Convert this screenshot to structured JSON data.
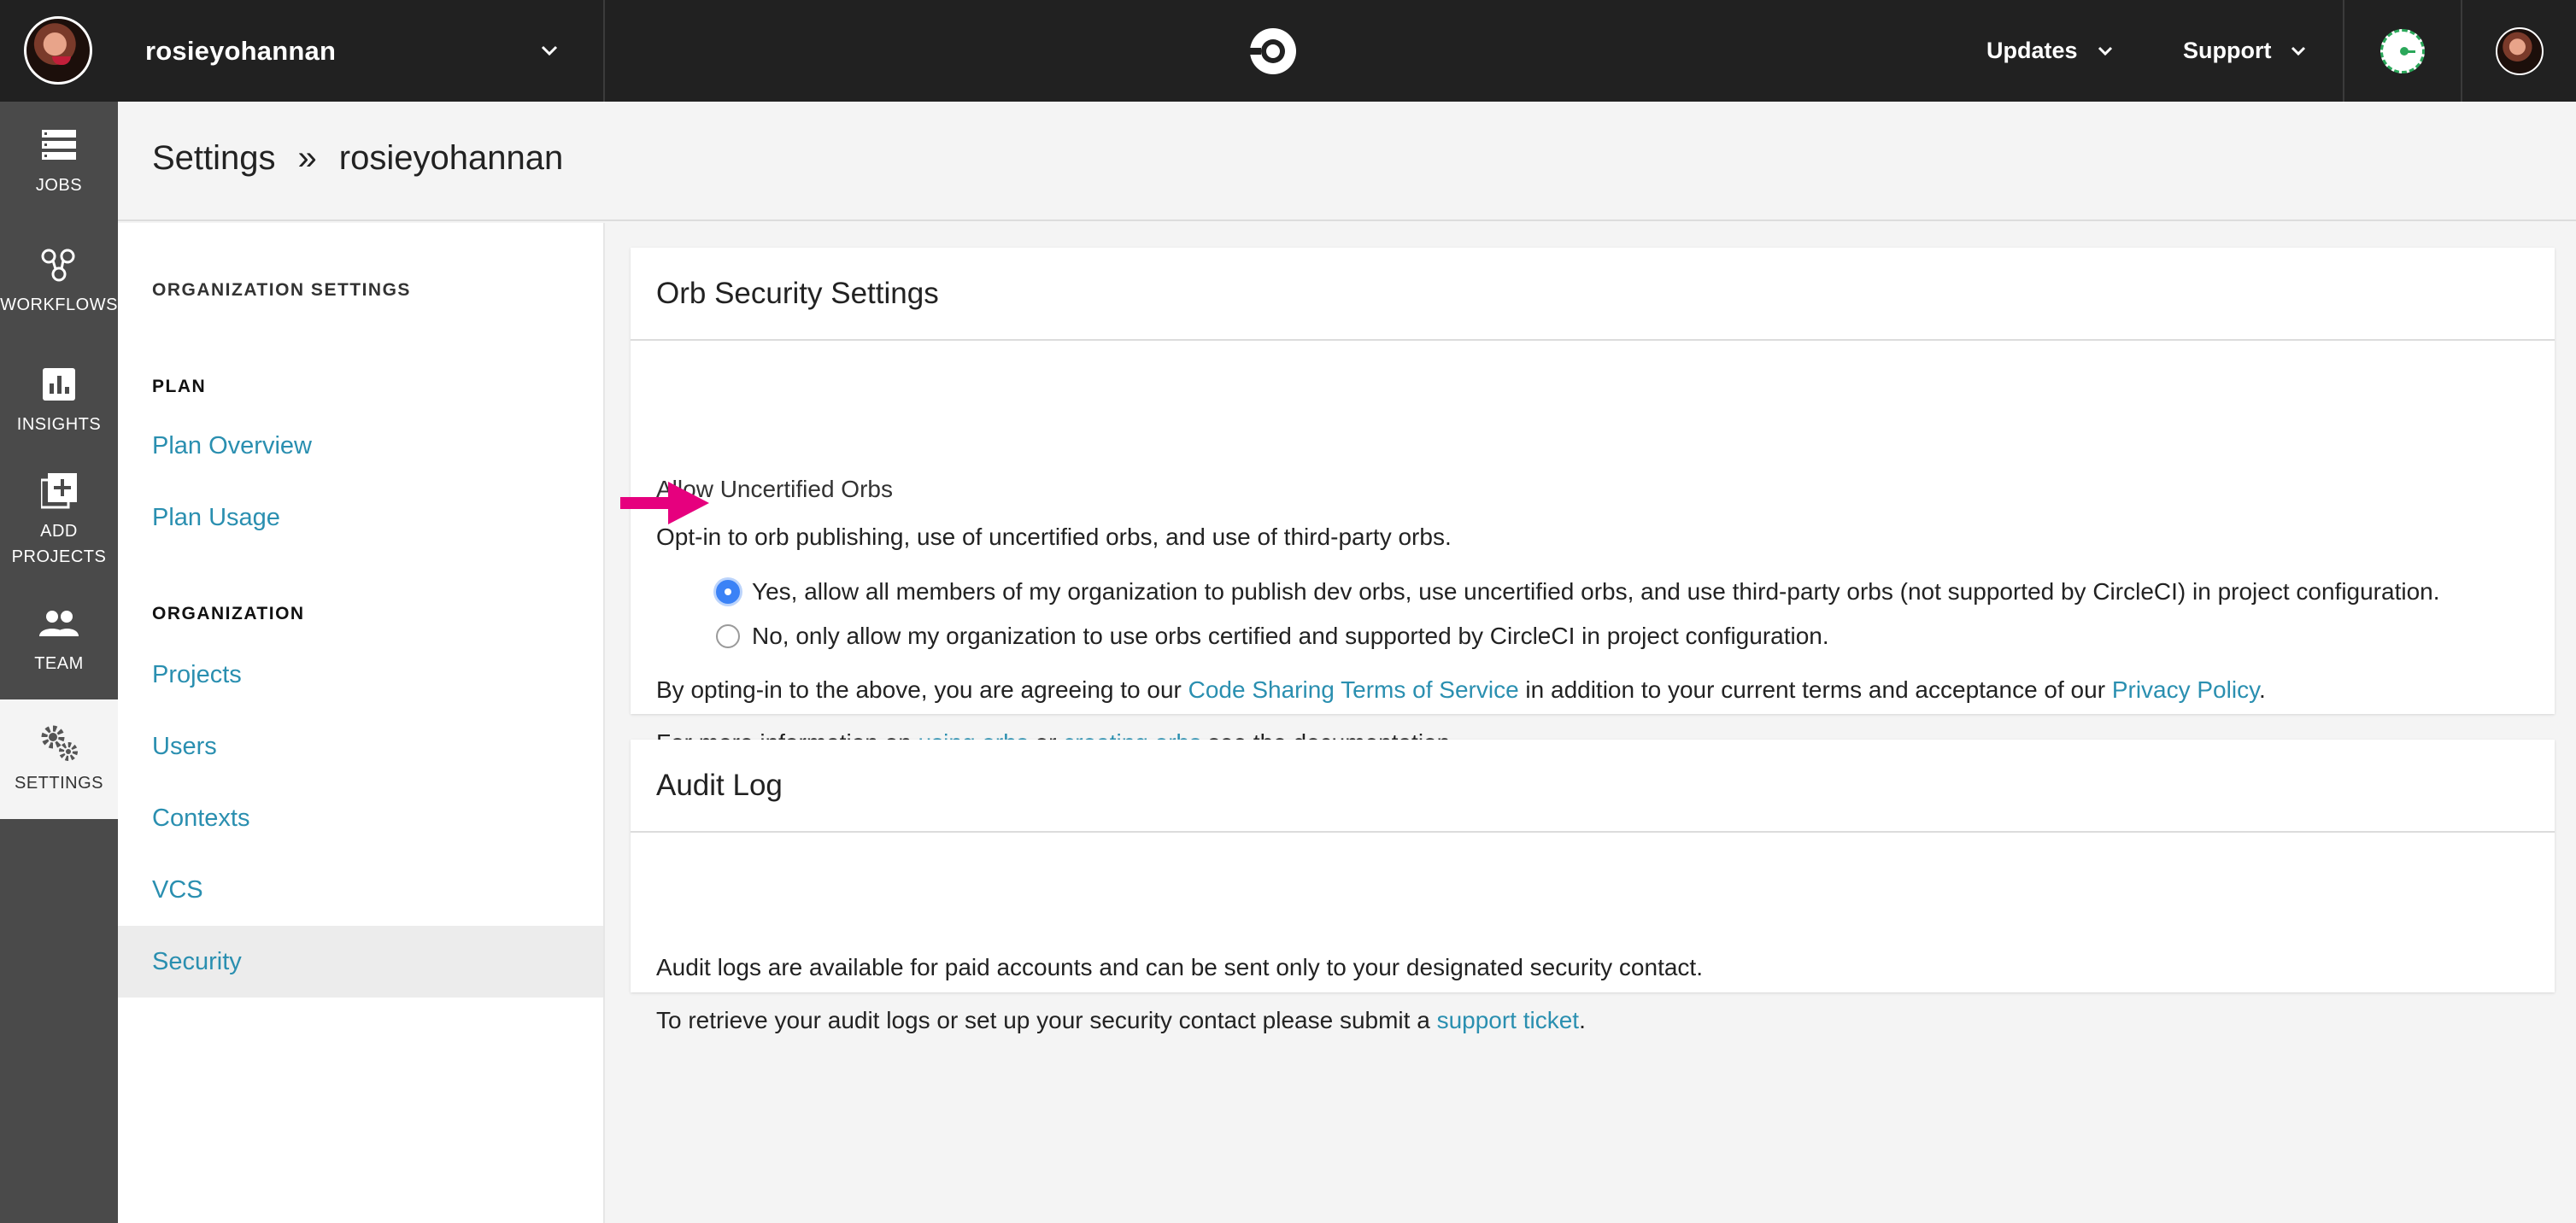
{
  "topbar": {
    "org_name": "rosieyohannan",
    "icons": {
      "avatar": "user-avatar",
      "org_dropdown": "chevron-down-icon",
      "logo": "circleci-logo",
      "status": "status-ring-icon",
      "user_avatar": "user-avatar-small"
    },
    "nav": [
      {
        "label": "Updates"
      },
      {
        "label": "Support"
      }
    ]
  },
  "rail": {
    "items": [
      {
        "label": "JOBS",
        "icon": "jobs-icon"
      },
      {
        "label": "WORKFLOWS",
        "icon": "workflows-icon"
      },
      {
        "label": "INSIGHTS",
        "icon": "insights-icon"
      },
      {
        "label": "ADD PROJECTS",
        "line1": "ADD",
        "line2": "PROJECTS",
        "icon": "add-projects-icon"
      },
      {
        "label": "TEAM",
        "icon": "team-icon"
      },
      {
        "label": "SETTINGS",
        "icon": "settings-icon",
        "active": true
      }
    ]
  },
  "header": {
    "breadcrumb": [
      "Settings",
      "»",
      "rosieyohannan"
    ]
  },
  "subnav": {
    "title": "ORGANIZATION SETTINGS",
    "plan_title": "PLAN",
    "plan_links": [
      "Plan Overview",
      "Plan Usage"
    ],
    "org_title": "ORGANIZATION",
    "org_links": [
      "Projects",
      "Users",
      "Contexts",
      "VCS",
      "Security"
    ],
    "active": "Security"
  },
  "orb_security": {
    "title": "Orb Security Settings",
    "subtitle": "Allow Uncertified Orbs",
    "description": "Opt-in to orb publishing, use of uncertified orbs, and use of third-party orbs.",
    "options": [
      {
        "label": "Yes, allow all members of my organization to publish dev orbs, use uncertified orbs, and use third-party orbs (not supported by CircleCI) in project configuration.",
        "selected": true
      },
      {
        "label": "No, only allow my organization to use orbs certified and supported by CircleCI in project configuration.",
        "selected": false
      }
    ],
    "agree_prefix": "By opting-in to the above, you are agreeing to our ",
    "agree_link1": "Code Sharing Terms of Service",
    "agree_middle": " in addition to your current terms and acceptance of our ",
    "agree_link2": "Privacy Policy",
    "agree_suffix": ".",
    "info_prefix": "For more information on ",
    "info_link1": "using orbs",
    "info_middle": " or ",
    "info_link2": "creating orbs",
    "info_suffix": " see the documentation."
  },
  "audit_log": {
    "title": "Audit Log",
    "line1": "Audit logs are available for paid accounts and can be sent only to your designated security contact.",
    "line2_prefix": "To retrieve your audit logs or set up your security contact please submit a ",
    "line2_link": "support ticket",
    "line2_suffix": "."
  },
  "colors": {
    "topbar": "#212121",
    "rail": "#4a4a4a",
    "link": "#2a8fb0",
    "radio_selected": "#3b82f6",
    "annotation_arrow": "#e6007e"
  }
}
